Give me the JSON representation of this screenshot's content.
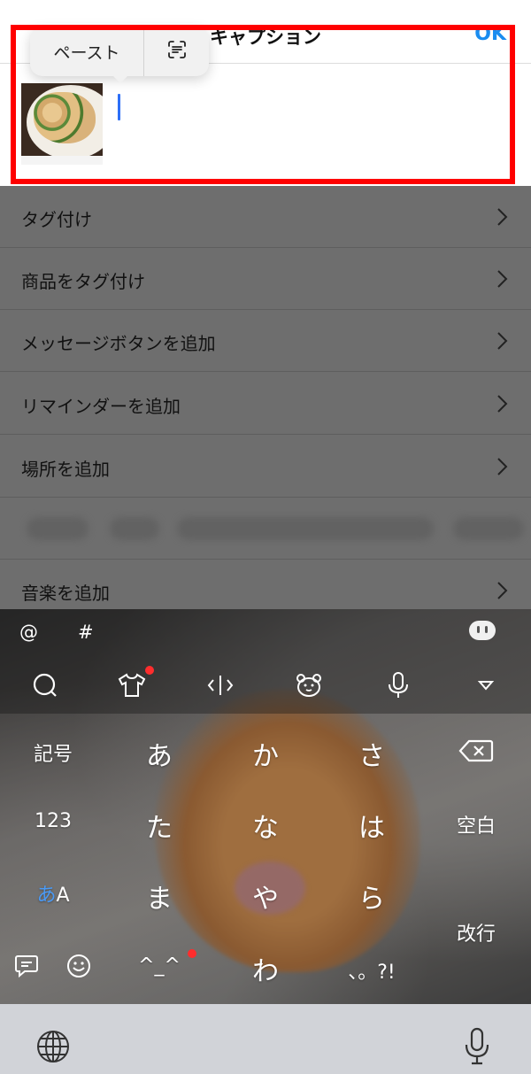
{
  "header": {
    "title": "キャプション",
    "ok_label": "OK"
  },
  "popup": {
    "paste_label": "ペースト",
    "scan_icon": "scan-text-icon"
  },
  "menu": {
    "items": [
      {
        "label": "タグ付け"
      },
      {
        "label": "商品をタグ付け"
      },
      {
        "label": "メッセージボタンを追加"
      },
      {
        "label": "リマインダーを追加"
      },
      {
        "label": "場所を追加"
      },
      {
        "label": "音楽を追加"
      }
    ]
  },
  "keyboard": {
    "symbols": [
      "@",
      "#"
    ],
    "toolbar_icons": [
      "search-icon",
      "shirt-icon",
      "cursor-icon",
      "bear-face-icon",
      "mic-icon",
      "collapse-icon"
    ],
    "rows": [
      [
        "記号",
        "あ",
        "か",
        "さ"
      ],
      [
        "123",
        "た",
        "な",
        "は",
        "空白"
      ],
      [
        "あ",
        "A",
        "ま",
        "や",
        "ら",
        "改行"
      ],
      [
        "わ",
        "、。?!",
        "^_^"
      ]
    ],
    "keys": {
      "kigo": "記号",
      "a": "あ",
      "ka": "か",
      "sa": "さ",
      "num": "123",
      "ta": "た",
      "na": "な",
      "ha": "は",
      "space": "空白",
      "mode_kana": "あ",
      "mode_alpha": "A",
      "ma": "ま",
      "ya": "や",
      "ra": "ら",
      "enter": "改行",
      "kaomoji": "^_^",
      "wa": "わ",
      "punct": "、。?!"
    }
  },
  "colors": {
    "accent": "#1a8cf0",
    "highlight": "#ff0000",
    "cursor": "#2d6ff7",
    "notification_dot": "#ff2d2d"
  }
}
